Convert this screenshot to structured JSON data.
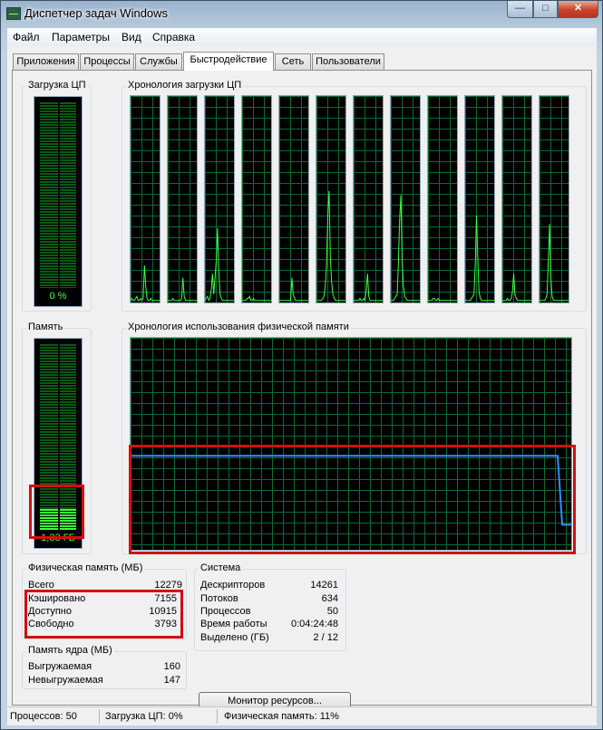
{
  "window": {
    "title": "Диспетчер задач Windows",
    "minimize_glyph": "—",
    "maximize_glyph": "□",
    "close_glyph": "✕"
  },
  "menu": [
    "Файл",
    "Параметры",
    "Вид",
    "Справка"
  ],
  "tabs": [
    "Приложения",
    "Процессы",
    "Службы",
    "Быстродействие",
    "Сеть",
    "Пользователи"
  ],
  "active_tab": "Быстродействие",
  "cpu": {
    "usage_label": "Загрузка ЦП",
    "usage_value": "0 %",
    "usage_fraction": 0.0,
    "history_label": "Хронология загрузки ЦП",
    "core_count": 12,
    "core_history": [
      [
        1,
        2,
        1,
        1,
        2,
        3,
        1,
        1,
        2,
        1,
        2,
        18,
        8,
        2,
        1,
        1,
        2,
        1,
        1,
        1,
        1,
        1,
        1,
        1
      ],
      [
        1,
        1,
        1,
        1,
        2,
        1,
        1,
        1,
        1,
        1,
        1,
        2,
        12,
        3,
        1,
        1,
        1,
        1,
        1,
        1,
        1,
        1,
        1,
        1
      ],
      [
        1,
        2,
        3,
        1,
        2,
        6,
        14,
        4,
        12,
        20,
        36,
        15,
        4,
        2,
        1,
        1,
        1,
        1,
        1,
        1,
        1,
        1,
        1,
        1
      ],
      [
        1,
        1,
        1,
        1,
        2,
        2,
        3,
        1,
        1,
        2,
        1,
        1,
        1,
        1,
        1,
        1,
        1,
        1,
        1,
        1,
        1,
        1,
        1,
        1
      ],
      [
        1,
        1,
        1,
        1,
        1,
        1,
        1,
        1,
        1,
        1,
        12,
        4,
        2,
        1,
        1,
        1,
        1,
        1,
        1,
        1,
        1,
        1,
        1,
        1
      ],
      [
        1,
        1,
        1,
        1,
        1,
        2,
        3,
        8,
        18,
        42,
        54,
        22,
        10,
        4,
        2,
        1,
        1,
        1,
        1,
        1,
        1,
        1,
        1,
        1
      ],
      [
        1,
        1,
        1,
        1,
        1,
        2,
        1,
        1,
        2,
        1,
        6,
        14,
        3,
        1,
        1,
        1,
        1,
        1,
        1,
        1,
        1,
        1,
        1,
        1
      ],
      [
        1,
        1,
        1,
        2,
        3,
        4,
        18,
        40,
        52,
        20,
        8,
        3,
        2,
        1,
        1,
        1,
        1,
        1,
        1,
        1,
        1,
        1,
        1,
        1
      ],
      [
        1,
        1,
        1,
        1,
        2,
        2,
        1,
        1,
        2,
        1,
        1,
        1,
        1,
        1,
        1,
        1,
        1,
        1,
        1,
        1,
        1,
        1,
        1,
        1
      ],
      [
        1,
        1,
        1,
        1,
        1,
        2,
        3,
        4,
        18,
        42,
        22,
        5,
        2,
        1,
        1,
        1,
        1,
        1,
        1,
        1,
        1,
        1,
        1,
        1
      ],
      [
        1,
        1,
        1,
        1,
        2,
        1,
        1,
        2,
        5,
        14,
        4,
        2,
        1,
        1,
        1,
        1,
        1,
        1,
        1,
        1,
        1,
        1,
        1,
        1
      ],
      [
        1,
        1,
        1,
        1,
        1,
        2,
        4,
        20,
        38,
        12,
        3,
        1,
        1,
        1,
        1,
        1,
        1,
        1,
        1,
        1,
        1,
        1,
        1,
        1
      ]
    ]
  },
  "memory": {
    "usage_label": "Память",
    "usage_value": "1,33 ГБ",
    "usage_fraction": 0.11,
    "history_label": "Хронология использования физической памяти",
    "history_percent": [
      11,
      11,
      11,
      11,
      11,
      11,
      11,
      11,
      11,
      11,
      11,
      11,
      11,
      11,
      11,
      11,
      11,
      11,
      11,
      11,
      11,
      11,
      11,
      11,
      11,
      11,
      11,
      11,
      11,
      11,
      11,
      11,
      11,
      11,
      11,
      11,
      11,
      11,
      11,
      11,
      11,
      11,
      11,
      11,
      11,
      11,
      11,
      11,
      11,
      11,
      11,
      11,
      11,
      11,
      11,
      11,
      11,
      11,
      11,
      11,
      11,
      11,
      11,
      11,
      11,
      11,
      11,
      11,
      11,
      11,
      11,
      11,
      11,
      11,
      11,
      11,
      11,
      11,
      11,
      11,
      11,
      11,
      11,
      11,
      11,
      11,
      11,
      11,
      11,
      11,
      11,
      11,
      11,
      11,
      11,
      1,
      1,
      1
    ]
  },
  "physical_memory": {
    "title": "Физическая память (МБ)",
    "rows": [
      {
        "label": "Всего",
        "value": "12279"
      },
      {
        "label": "Кэшировано",
        "value": "7155"
      },
      {
        "label": "Доступно",
        "value": "10915"
      },
      {
        "label": "Свободно",
        "value": "3793"
      }
    ]
  },
  "kernel_memory": {
    "title": "Память ядра (МБ)",
    "rows": [
      {
        "label": "Выгружаемая",
        "value": "160"
      },
      {
        "label": "Невыгружаемая",
        "value": "147"
      }
    ]
  },
  "system": {
    "title": "Система",
    "rows": [
      {
        "label": "Дескрипторов",
        "value": "14261"
      },
      {
        "label": "Потоков",
        "value": "634"
      },
      {
        "label": "Процессов",
        "value": "50"
      },
      {
        "label": "Время работы",
        "value": "0:04:24:48"
      },
      {
        "label": "Выделено (ГБ)",
        "value": "2 / 12"
      }
    ]
  },
  "resource_monitor_button": "Монитор ресурсов...",
  "status": {
    "processes": "Процессов: 50",
    "cpu": "Загрузка ЦП: 0%",
    "memory": "Физическая память: 11%"
  },
  "colors": {
    "graph_line_cpu": "#3cff3c",
    "graph_line_memory": "#2f8fff",
    "highlight": "#d60d0d",
    "grid": "#0a6a36"
  }
}
